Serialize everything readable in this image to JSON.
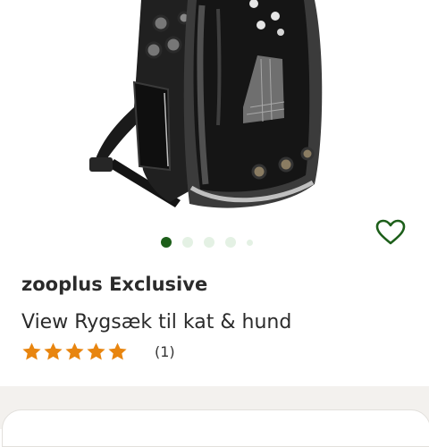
{
  "product": {
    "brand": "zooplus Exclusive",
    "title": "View Rygsæk til kat & hund",
    "rating_value": 5,
    "rating_max": 5,
    "review_count_label": "(1)",
    "image_count": 5,
    "active_image_index": 0
  },
  "icons": {
    "wishlist": "heart-outline-icon",
    "rating_star": "star-icon"
  },
  "colors": {
    "wishlist_heart": "#1d5f1a",
    "active_dot": "#1d5f1a",
    "inactive_dot": "#e4f1e4",
    "star": "#e8850f",
    "lower_background": "#f3f1ee"
  }
}
